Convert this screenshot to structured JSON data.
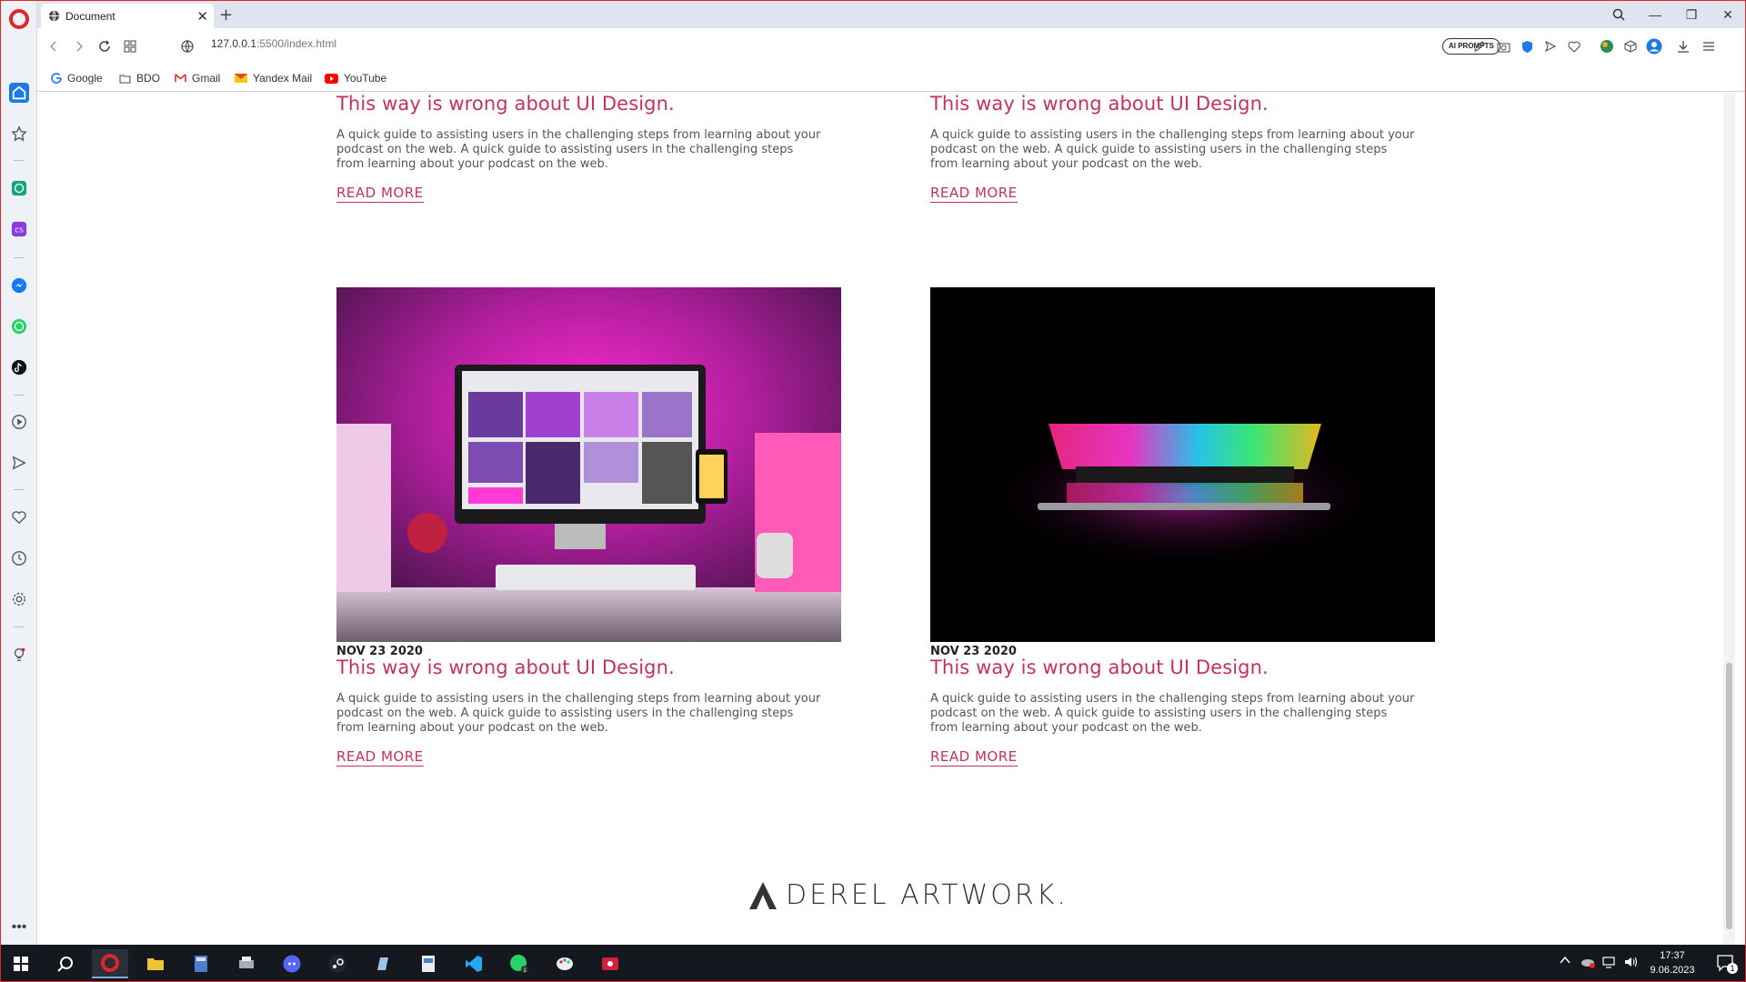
{
  "browser": {
    "tab_title": "Document",
    "new_tab_label": "+",
    "address": {
      "host": "127.0.0.1",
      "path": ":5500/index.html"
    },
    "ai_prompts_label": "AI PROMPTS",
    "bookmarks": [
      {
        "label": "Google",
        "icon": "google-icon"
      },
      {
        "label": "BDO",
        "icon": "folder-icon"
      },
      {
        "label": "Gmail",
        "icon": "gmail-icon"
      },
      {
        "label": "Yandex Mail",
        "icon": "yandex-mail-icon"
      },
      {
        "label": "YouTube",
        "icon": "youtube-icon"
      }
    ]
  },
  "page": {
    "cards": [
      {
        "date": "",
        "title": "This way is wrong about UI Design.",
        "text": "A quick guide to assisting users in the challenging steps from learning about your podcast on the web. A quick guide to assisting users in the challenging steps from learning about your podcast on the web.",
        "read_more": "READ MORE"
      },
      {
        "date": "",
        "title": "This way is wrong about UI Design.",
        "text": "A quick guide to assisting users in the challenging steps from learning about your podcast on the web. A quick guide to assisting users in the challenging steps from learning about your podcast on the web.",
        "read_more": "READ MORE"
      },
      {
        "date": "NOV 23 2020",
        "title": "This way is wrong about UI Design.",
        "text": "A quick guide to assisting users in the challenging steps from learning about your podcast on the web. A quick guide to assisting users in the challenging steps from learning about your podcast on the web.",
        "read_more": "READ MORE",
        "image": "pink-desk-setup-imac"
      },
      {
        "date": "NOV 23 2020",
        "title": "This way is wrong about UI Design.",
        "text": "A quick guide to assisting users in the challenging steps from learning about your podcast on the web. A quick guide to assisting users in the challenging steps from learning about your podcast on the web.",
        "read_more": "READ MORE",
        "image": "rgb-laptop-dark"
      }
    ],
    "footer_logo": "DEREL ARTWORK."
  },
  "taskbar": {
    "time": "17:37",
    "date": "9.06.2023",
    "notification_count": "1"
  },
  "colors": {
    "accent": "#c0345a",
    "opera_red": "#e0262b"
  }
}
